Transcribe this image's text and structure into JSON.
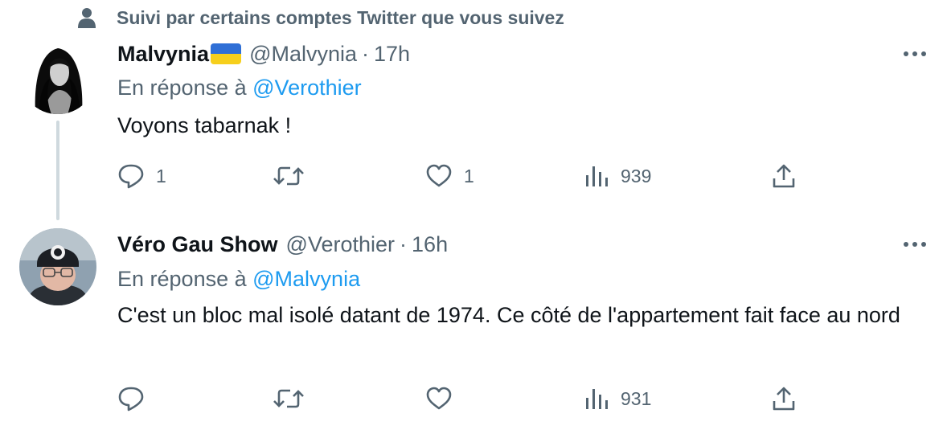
{
  "social_context": {
    "icon": "person-icon",
    "text": "Suivi par certains comptes Twitter que vous suivez"
  },
  "tweets": [
    {
      "display_name": "Malvynia",
      "flag": "ukraine-flag",
      "handle": "@Malvynia",
      "separator": "·",
      "time": "17h",
      "reply_prefix": "En réponse à",
      "reply_mention": "@Verothier",
      "text": "Voyons tabarnak !",
      "actions": {
        "reply": "1",
        "retweet": "",
        "like": "1",
        "views": "939"
      }
    },
    {
      "display_name": "Véro Gau Show",
      "handle": "@Verothier",
      "separator": "·",
      "time": "16h",
      "reply_prefix": "En réponse à",
      "reply_mention": "@Malvynia",
      "text": "C'est un bloc mal isolé datant de 1974. Ce côté de l'appartement fait face au nord",
      "actions": {
        "reply": "",
        "retweet": "",
        "like": "",
        "views": "931"
      }
    }
  ],
  "colors": {
    "text_primary": "#0f1419",
    "text_secondary": "#536471",
    "accent": "#1d9bf0",
    "thread_line": "#cfd9de"
  }
}
